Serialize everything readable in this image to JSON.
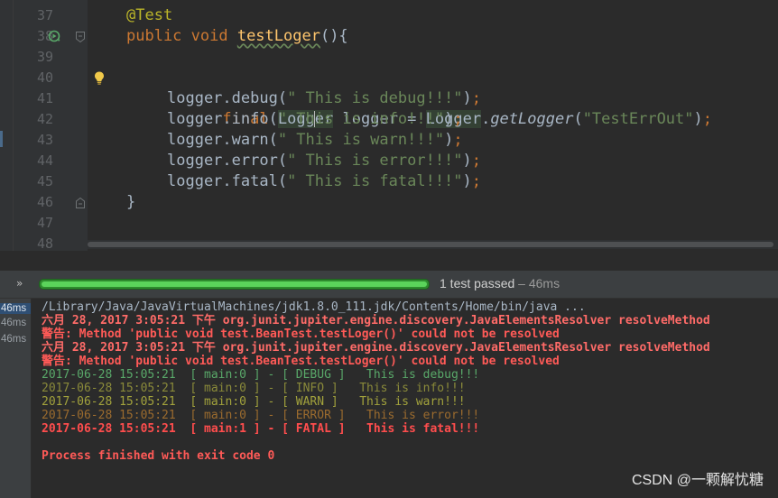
{
  "editor": {
    "line_numbers": [
      "37",
      "38",
      "39",
      "40",
      "41",
      "42",
      "43",
      "44",
      "45",
      "46",
      "47",
      "48"
    ],
    "annotation": "@Test",
    "method_modifiers": "public void ",
    "method_name": "testLoger",
    "method_paren": "(){",
    "decl_final": "final ",
    "decl_type_a": "Logg",
    "decl_type_b": "er",
    "decl_var": " logger = ",
    "decl_factory": "Logger",
    "decl_dot": ".",
    "decl_method": "getLogger",
    "decl_open": "(",
    "decl_arg": "\"TestErrOut\"",
    "decl_close": ")",
    "semicolon": ";",
    "calls": [
      {
        "prefix": "logger.debug(",
        "arg": "\" This is debug!!!\"",
        "suffix": ")"
      },
      {
        "prefix": "logger.info(",
        "arg": "\" This is info!!!\"",
        "suffix": ")"
      },
      {
        "prefix": "logger.warn(",
        "arg": "\" This is warn!!!\"",
        "suffix": ")"
      },
      {
        "prefix": "logger.error(",
        "arg": "\" This is error!!!\"",
        "suffix": ")"
      },
      {
        "prefix": "logger.fatal(",
        "arg": "\" This is fatal!!!\"",
        "suffix": ")"
      }
    ],
    "closing_brace": "}"
  },
  "run_panel": {
    "expand_label": "»",
    "status_text": "1 test passed",
    "status_sep": " – ",
    "status_time": "46ms",
    "progress": 1.0,
    "durations": [
      "46ms",
      "46ms",
      "46ms"
    ]
  },
  "console": {
    "lines": [
      {
        "style": "gray",
        "text": "/Library/Java/JavaVirtualMachines/jdk1.8.0_111.jdk/Contents/Home/bin/java ..."
      },
      {
        "style": "red",
        "text": "六月 28, 2017 3:05:21 下午 org.junit.jupiter.engine.discovery.JavaElementsResolver resolveMethod"
      },
      {
        "style": "red-b",
        "text": "警告: Method 'public void test.BeanTest.testLoger()' could not be resolved"
      },
      {
        "style": "red",
        "text": "六月 28, 2017 3:05:21 下午 org.junit.jupiter.engine.discovery.JavaElementsResolver resolveMethod"
      },
      {
        "style": "red-b",
        "text": "警告: Method 'public void test.BeanTest.testLoger()' could not be resolved"
      },
      {
        "style": "debug",
        "text": "2017-06-28 15:05:21  [ main:0 ] - [ DEBUG ]   This is debug!!!"
      },
      {
        "style": "info",
        "text": "2017-06-28 15:05:21  [ main:0 ] - [ INFO ]   This is info!!!"
      },
      {
        "style": "warn",
        "text": "2017-06-28 15:05:21  [ main:0 ] - [ WARN ]   This is warn!!!"
      },
      {
        "style": "error",
        "text": "2017-06-28 15:05:21  [ main:0 ] - [ ERROR ]   This is error!!!"
      },
      {
        "style": "fatal",
        "text": "2017-06-28 15:05:21  [ main:1 ] - [ FATAL ]   This is fatal!!!"
      },
      {
        "style": "blank",
        "text": ""
      },
      {
        "style": "red-b",
        "text": "Process finished with exit code 0"
      }
    ]
  },
  "watermark": "CSDN @一颗解忧糖",
  "colors": {
    "editor_bg": "#2b2b2b",
    "keyword": "#cc7832",
    "string": "#6a8759",
    "annotation": "#bbb529",
    "method": "#ffc66d",
    "error_text": "#ff6b68",
    "progress_green": "#5bd35b"
  }
}
